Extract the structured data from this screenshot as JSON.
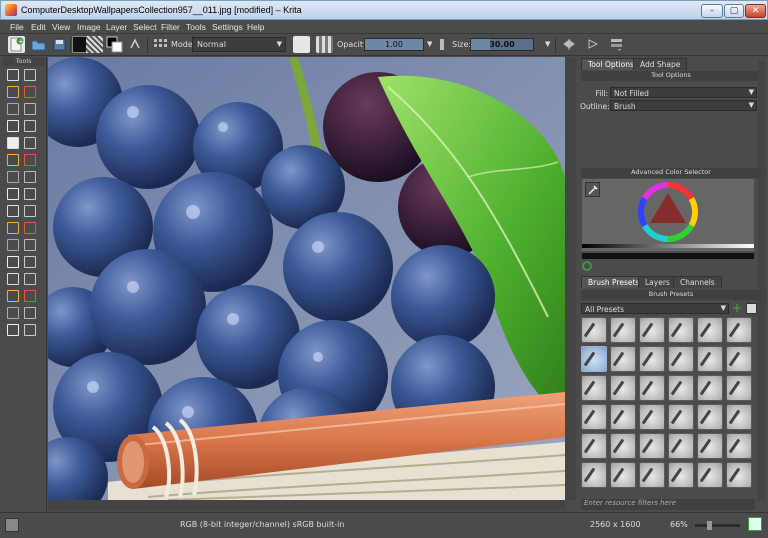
{
  "window": {
    "title": "ComputerDesktopWallpapersCollection957__011.jpg [modified] – Krita",
    "buttons": [
      "–",
      "▢",
      "✕"
    ]
  },
  "menu": [
    "File",
    "Edit",
    "View",
    "Image",
    "Layer",
    "Select",
    "Filter",
    "Tools",
    "Settings",
    "Help"
  ],
  "toolbar": {
    "mode_label": "Mode:",
    "mode_value": "Normal",
    "opacity_label": "Opacity:",
    "opacity_value": "1.00",
    "opacity_fraction": 1.0,
    "size_label": "Size:",
    "size_value": "30.00",
    "size_fraction": 0.3
  },
  "toolbox": {
    "title": "Tools"
  },
  "dock": {
    "tabs_top": [
      "Tool Options",
      "Add Shape"
    ],
    "tool_options_title": "Tool Options",
    "fill_label": "Fill:",
    "fill_value": "Not Filled",
    "outline_label": "Outline:",
    "outline_value": "Brush",
    "color_selector_title": "Advanced Color Selector",
    "tabs_bottom": [
      "Brush Presets",
      "Layers",
      "Channels"
    ],
    "brush_presets_title": "Brush Presets",
    "presets_filter": "All Presets",
    "resource_filter_placeholder": "Enter resource filters here"
  },
  "status": {
    "color_space": "RGB (8-bit integer/channel)  sRGB built-in",
    "dimensions": "2560 x 1600",
    "zoom": "66%"
  },
  "colors": {
    "ui_bg": "#4b4b4b",
    "accent": "#5a6f8a",
    "add_button": "#3c9a3c"
  }
}
